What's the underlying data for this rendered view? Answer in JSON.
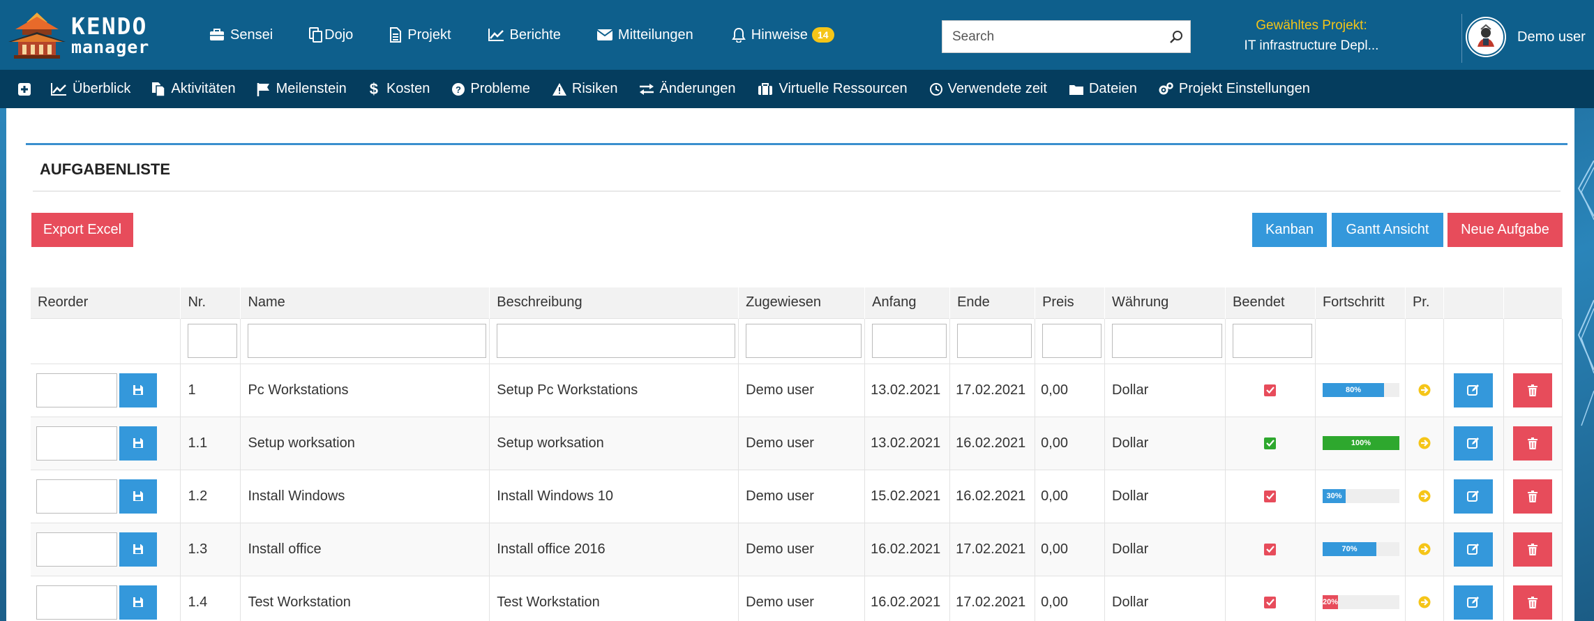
{
  "app": {
    "logo_line1": "KENDO",
    "logo_line2": "manager"
  },
  "topnav": [
    {
      "label": "Sensei",
      "icon": "briefcase-icon"
    },
    {
      "label": "Dojo",
      "icon": "copy-icon"
    },
    {
      "label": "Projekt",
      "icon": "file-icon"
    },
    {
      "label": "Berichte",
      "icon": "chart-line-icon"
    },
    {
      "label": "Mitteilungen",
      "icon": "envelope-icon"
    },
    {
      "label": "Hinweise",
      "icon": "bell-icon",
      "badge": "14"
    }
  ],
  "search": {
    "placeholder": "Search"
  },
  "project": {
    "label": "Gewähltes Projekt:",
    "value": "IT infrastructure Depl..."
  },
  "user": {
    "name": "Demo user"
  },
  "subnav": [
    {
      "label": "",
      "icon": "plus-square-icon"
    },
    {
      "label": "Überblick",
      "icon": "area-chart-icon"
    },
    {
      "label": "Aktivitäten",
      "icon": "copy-icon"
    },
    {
      "label": "Meilenstein",
      "icon": "flag-icon"
    },
    {
      "label": "Kosten",
      "icon": "dollar-icon"
    },
    {
      "label": "Probleme",
      "icon": "question-circle-icon"
    },
    {
      "label": "Risiken",
      "icon": "warning-icon"
    },
    {
      "label": "Änderungen",
      "icon": "exchange-icon"
    },
    {
      "label": "Virtuelle Ressourcen",
      "icon": "suitcase-icon"
    },
    {
      "label": "Verwendete zeit",
      "icon": "clock-icon"
    },
    {
      "label": "Dateien",
      "icon": "folder-icon"
    },
    {
      "label": "Projekt Einstellungen",
      "icon": "cogs-icon"
    }
  ],
  "panel": {
    "title": "AUFGABENLISTE",
    "export_label": "Export Excel",
    "kanban_label": "Kanban",
    "gantt_label": "Gantt Ansicht",
    "new_task_label": "Neue Aufgabe"
  },
  "table": {
    "headers": [
      "Reorder",
      "Nr.",
      "Name",
      "Beschreibung",
      "Zugewiesen",
      "Anfang",
      "Ende",
      "Preis",
      "Währung",
      "Beendet",
      "Fortschritt",
      "Pr.",
      "",
      ""
    ],
    "rows": [
      {
        "nr": "1",
        "name": "Pc Workstations",
        "desc": "Setup Pc Workstations",
        "assigned": "Demo user",
        "start": "13.02.2021",
        "end": "17.02.2021",
        "price": "0,00",
        "currency": "Dollar",
        "done": false,
        "progress": 80,
        "progress_label": "80%",
        "progress_color": "#3498db"
      },
      {
        "nr": "1.1",
        "name": "Setup worksation",
        "desc": "Setup worksation",
        "assigned": "Demo user",
        "start": "13.02.2021",
        "end": "16.02.2021",
        "price": "0,00",
        "currency": "Dollar",
        "done": true,
        "progress": 100,
        "progress_label": "100%",
        "progress_color": "#2ea82e"
      },
      {
        "nr": "1.2",
        "name": "Install Windows",
        "desc": "Install Windows 10",
        "assigned": "Demo user",
        "start": "15.02.2021",
        "end": "16.02.2021",
        "price": "0,00",
        "currency": "Dollar",
        "done": false,
        "progress": 30,
        "progress_label": "30%",
        "progress_color": "#3498db"
      },
      {
        "nr": "1.3",
        "name": "Install office",
        "desc": "Install office 2016",
        "assigned": "Demo user",
        "start": "16.02.2021",
        "end": "17.02.2021",
        "price": "0,00",
        "currency": "Dollar",
        "done": false,
        "progress": 70,
        "progress_label": "70%",
        "progress_color": "#3498db"
      },
      {
        "nr": "1.4",
        "name": "Test Workstation",
        "desc": "Test Workstation",
        "assigned": "Demo user",
        "start": "16.02.2021",
        "end": "17.02.2021",
        "price": "0,00",
        "currency": "Dollar",
        "done": false,
        "progress": 20,
        "progress_label": "20%",
        "progress_color": "#e74c5b"
      }
    ]
  },
  "colors": {
    "topbar": "#0e5f8c",
    "subnav": "#053d5e",
    "accent_blue": "#3498db",
    "accent_red": "#e74c5b",
    "badge": "#f5c518",
    "done_green": "#2ea82e",
    "not_done_red": "#e74c5b",
    "priority_yellow": "#f5c518"
  }
}
